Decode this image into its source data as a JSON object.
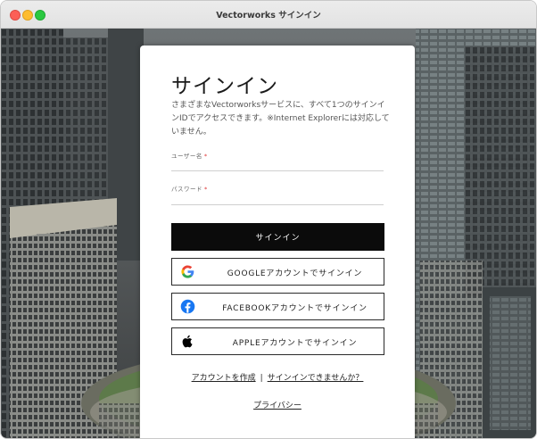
{
  "window": {
    "title": "Vectorworks サインイン"
  },
  "signin": {
    "heading": "サインイン",
    "intro": "さまざまなVectorworksサービスに、すべて1つのサインインIDでアクセスできます。※Internet Explorerには対応していません。",
    "username_label": "ユーザー名",
    "password_label": "パスワード",
    "required_mark": "*",
    "username_value": "",
    "password_value": "",
    "signin_button": "サインイン",
    "google_button": "GOOGLEアカウントでサインイン",
    "facebook_button": "FACEBOOKアカウントでサインイン",
    "apple_button": "APPLEアカウントでサインイン",
    "create_account_link": "アカウントを作成",
    "separator": "|",
    "trouble_link": "サインインできませんか？",
    "privacy_link": "プライバシー"
  },
  "icons": {
    "google": "google-icon",
    "facebook": "facebook-icon",
    "apple": "apple-icon"
  },
  "colors": {
    "primary_button": "#0b0b0b",
    "facebook_blue": "#1877f2",
    "google_blue": "#4285f4",
    "google_red": "#ea4335",
    "google_yellow": "#fbbc05",
    "google_green": "#34a853"
  }
}
